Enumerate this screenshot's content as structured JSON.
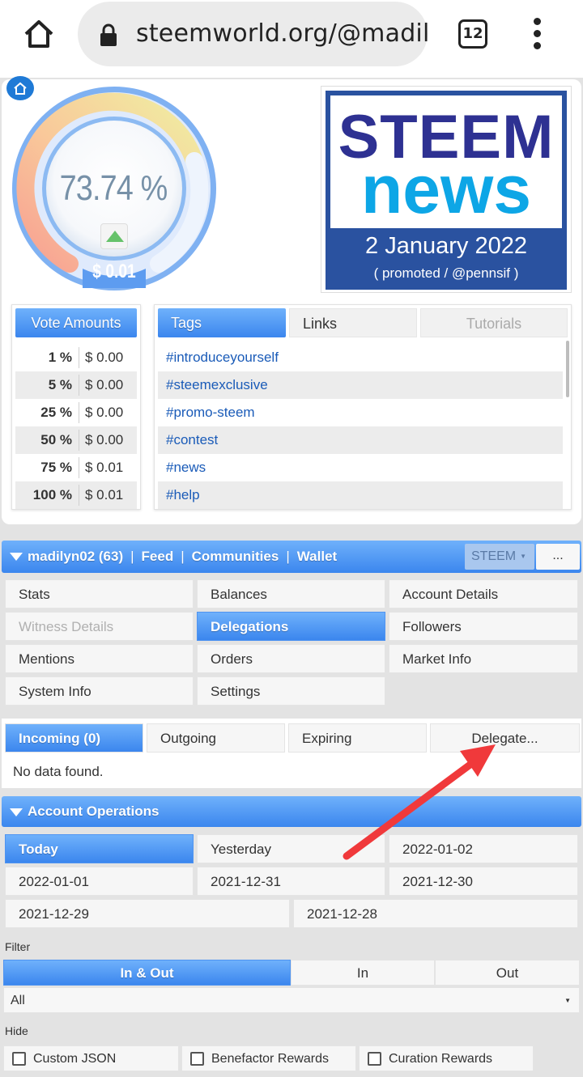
{
  "browser": {
    "url": "steemworld.org/@madil",
    "tab_count": "12"
  },
  "gauge": {
    "vote_power": "73.74 %",
    "vote_value": "$ 0.01"
  },
  "news": {
    "line1": "STEEM",
    "line2": "news",
    "date": "2 January 2022",
    "promo": "( promoted / @pennsif )"
  },
  "vote_amounts": {
    "header": "Vote Amounts",
    "rows": [
      {
        "pct": "1 %",
        "value": "$ 0.00"
      },
      {
        "pct": "5 %",
        "value": "$ 0.00"
      },
      {
        "pct": "25 %",
        "value": "$ 0.00"
      },
      {
        "pct": "50 %",
        "value": "$ 0.00"
      },
      {
        "pct": "75 %",
        "value": "$ 0.01"
      },
      {
        "pct": "100 %",
        "value": "$ 0.01"
      }
    ]
  },
  "tags_panel": {
    "tabs": [
      "Tags",
      "Links",
      "Tutorials"
    ],
    "tags": [
      "#introduceyourself",
      "#steemexclusive",
      "#promo-steem",
      "#contest",
      "#news",
      "#help"
    ]
  },
  "account_bar": {
    "account": "madilyn02 (63)",
    "links": [
      "Feed",
      "Communities",
      "Wallet"
    ],
    "separator": "|",
    "currency": "STEEM",
    "currency_caret": "▼",
    "more": "..."
  },
  "nav_grid": [
    "Stats",
    "Balances",
    "Account Details",
    "Witness Details",
    "Delegations",
    "Followers",
    "Mentions",
    "Orders",
    "Market Info",
    "System Info",
    "Settings"
  ],
  "delegation_tabs": [
    "Incoming (0)",
    "Outgoing",
    "Expiring",
    "Delegate..."
  ],
  "delegation_empty": "No data found.",
  "operations": {
    "title": "Account Operations",
    "dates": [
      "Today",
      "Yesterday",
      "2022-01-02",
      "2022-01-01",
      "2021-12-31",
      "2021-12-30",
      "2021-12-29",
      "2021-12-28"
    ],
    "filter_label": "Filter",
    "filter_options": [
      "In & Out",
      "In",
      "Out"
    ],
    "filter_select": "All",
    "filter_caret": "▼",
    "hide_label": "Hide",
    "hide_options": [
      "Custom JSON",
      "Benefactor Rewards",
      "Curation Rewards"
    ]
  },
  "colors": {
    "accent_blue": "#3b86ee",
    "annotation_arrow": "#f0393b",
    "news_navy": "#2e3192",
    "news_cyan": "#0da6e6"
  }
}
